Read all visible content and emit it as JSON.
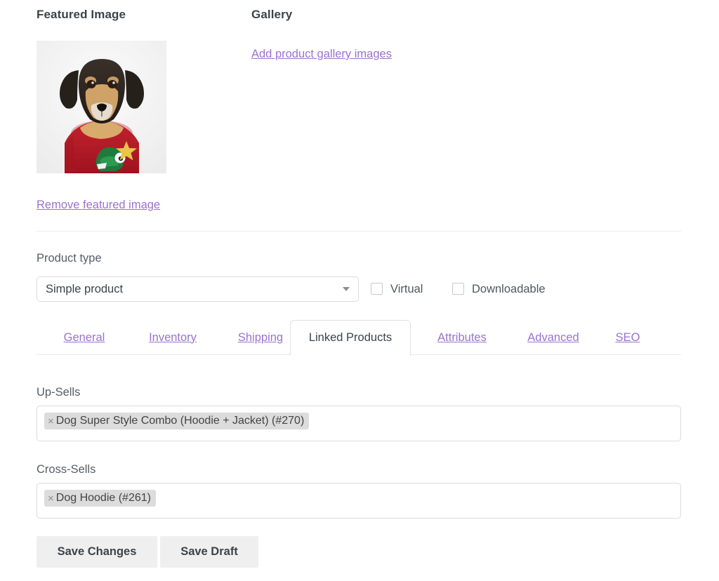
{
  "media": {
    "featured_heading": "Featured Image",
    "gallery_heading": "Gallery",
    "gallery_add_link": "Add product gallery images",
    "remove_featured_link": "Remove featured image",
    "featured_image_alt": "dog-in-red-dinosaur-sweater-photo"
  },
  "product_type": {
    "label": "Product type",
    "selected": "Simple product",
    "options": [
      "Simple product"
    ],
    "virtual": {
      "label": "Virtual",
      "checked": false
    },
    "downloadable": {
      "label": "Downloadable",
      "checked": false
    }
  },
  "tabs": {
    "active": "Linked Products",
    "items": [
      {
        "label": "General",
        "active": false
      },
      {
        "label": "Inventory",
        "active": false
      },
      {
        "label": "Shipping",
        "active": false
      },
      {
        "label": "Linked Products",
        "active": true
      },
      {
        "label": "Attributes",
        "active": false
      },
      {
        "label": "Advanced",
        "active": false
      },
      {
        "label": "SEO",
        "active": false
      }
    ]
  },
  "linked_products": {
    "upsells": {
      "label": "Up-Sells",
      "tags": [
        {
          "remove": "×",
          "text": "Dog Super Style Combo (Hoodie + Jacket) (#270)"
        }
      ]
    },
    "crosssells": {
      "label": "Cross-Sells",
      "tags": [
        {
          "remove": "×",
          "text": "Dog Hoodie (#261)"
        }
      ]
    }
  },
  "actions": {
    "save_changes": "Save Changes",
    "save_draft": "Save Draft"
  },
  "colors": {
    "link": "#9b72cf",
    "text": "#3c434a",
    "muted": "#555d66",
    "border": "#dcdcde",
    "tag_bg": "#dcdcdc",
    "button_bg": "#efefef"
  }
}
